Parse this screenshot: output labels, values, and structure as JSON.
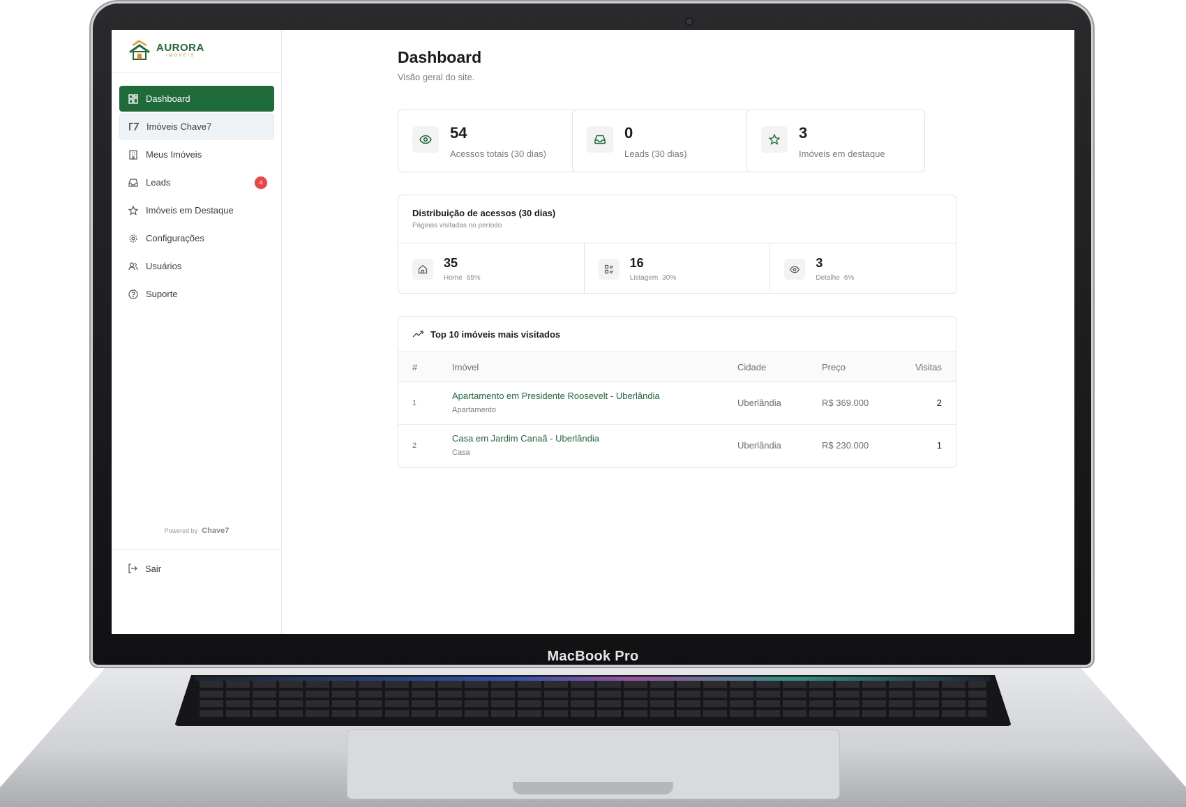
{
  "device": {
    "label": "MacBook Pro"
  },
  "brand": {
    "name": "AURORA",
    "sub": "IMÓVEIS"
  },
  "sidebar": {
    "items": [
      {
        "label": "Dashboard",
        "icon": "grid-icon",
        "active": true
      },
      {
        "label": "Imóveis Chave7",
        "icon": "chave7-icon"
      },
      {
        "label": "Meus Imóveis",
        "icon": "building-icon"
      },
      {
        "label": "Leads",
        "icon": "inbox-icon",
        "badge": "4"
      },
      {
        "label": "Imóveis em Destaque",
        "icon": "star-icon"
      },
      {
        "label": "Configurações",
        "icon": "gear-icon"
      },
      {
        "label": "Usuários",
        "icon": "users-icon"
      },
      {
        "label": "Suporte",
        "icon": "help-circle-icon"
      }
    ],
    "powered_by": "Powered by",
    "powered_logo": "Chave7",
    "logout": "Sair"
  },
  "header": {
    "title": "Dashboard",
    "subtitle": "Visão geral do site."
  },
  "stats": [
    {
      "value": "54",
      "label": "Acessos totais (30 dias)",
      "icon": "eye-icon"
    },
    {
      "value": "0",
      "label": "Leads (30 dias)",
      "icon": "inbox-icon"
    },
    {
      "value": "3",
      "label": "Imóveis em destaque",
      "icon": "star-icon"
    }
  ],
  "distribution": {
    "title": "Distribuição de acessos (30 dias)",
    "subtitle": "Páginas visitadas no período",
    "items": [
      {
        "value": "35",
        "label": "Home",
        "pct": "65%",
        "icon": "home-icon"
      },
      {
        "value": "16",
        "label": "Listagem",
        "pct": "30%",
        "icon": "list-icon"
      },
      {
        "value": "3",
        "label": "Detalhe",
        "pct": "6%",
        "icon": "eye-icon"
      }
    ]
  },
  "top": {
    "title": "Top 10 imóveis mais visitados",
    "columns": {
      "num": "#",
      "name": "Imóvel",
      "city": "Cidade",
      "price": "Preço",
      "visits": "Visitas"
    },
    "rows": [
      {
        "num": "1",
        "name": "Apartamento em Presidente Roosevelt - Uberlândia",
        "type": "Apartamento",
        "city": "Uberlândia",
        "price": "R$ 369.000",
        "visits": "2"
      },
      {
        "num": "2",
        "name": "Casa em Jardim Canaã - Uberlândia",
        "type": "Casa",
        "city": "Uberlândia",
        "price": "R$ 230.000",
        "visits": "1"
      }
    ]
  },
  "colors": {
    "accent": "#1f6b3a",
    "badge": "#ef4444",
    "brand_orange": "#e08a2c"
  }
}
